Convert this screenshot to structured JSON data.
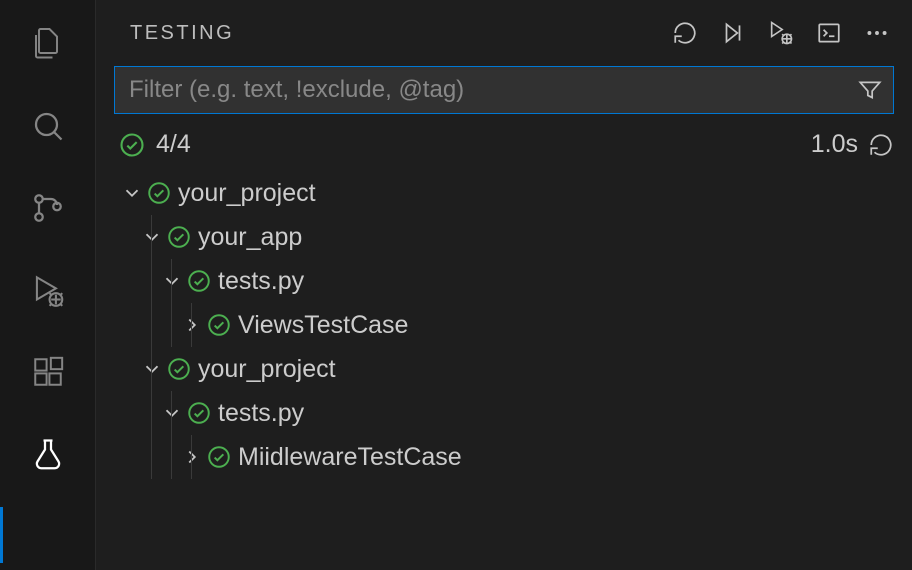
{
  "panel": {
    "title": "TESTING",
    "filter_placeholder": "Filter (e.g. text, !exclude, @tag)",
    "status_count": "4/4",
    "duration": "1.0s"
  },
  "colors": {
    "pass": "#4caf50"
  },
  "tree": [
    {
      "depth": 0,
      "expanded": true,
      "status": "pass",
      "label": "your_project"
    },
    {
      "depth": 1,
      "expanded": true,
      "status": "pass",
      "label": "your_app"
    },
    {
      "depth": 2,
      "expanded": true,
      "status": "pass",
      "label": "tests.py"
    },
    {
      "depth": 3,
      "expanded": false,
      "status": "pass",
      "label": "ViewsTestCase"
    },
    {
      "depth": 1,
      "expanded": true,
      "status": "pass",
      "label": "your_project"
    },
    {
      "depth": 2,
      "expanded": true,
      "status": "pass",
      "label": "tests.py"
    },
    {
      "depth": 3,
      "expanded": false,
      "status": "pass",
      "label": "MiidlewareTestCase"
    }
  ]
}
